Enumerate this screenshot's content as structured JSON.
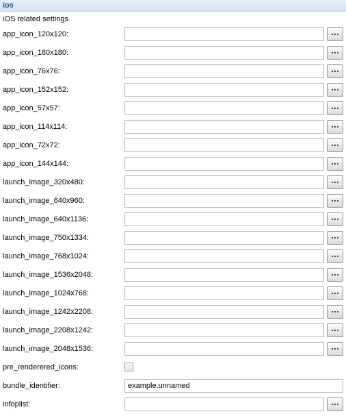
{
  "header": {
    "title": "ios"
  },
  "section_heading": "iOS related settings",
  "rows": [
    {
      "key": "app_icon_120x120",
      "label": "app_icon_120x120:",
      "type": "file",
      "value": ""
    },
    {
      "key": "app_icon_180x180",
      "label": "app_icon_180x180:",
      "type": "file",
      "value": ""
    },
    {
      "key": "app_icon_76x76",
      "label": "app_icon_76x76:",
      "type": "file",
      "value": ""
    },
    {
      "key": "app_icon_152x152",
      "label": "app_icon_152x152:",
      "type": "file",
      "value": ""
    },
    {
      "key": "app_icon_57x57",
      "label": "app_icon_57x57:",
      "type": "file",
      "value": ""
    },
    {
      "key": "app_icon_114x114",
      "label": "app_icon_114x114:",
      "type": "file",
      "value": ""
    },
    {
      "key": "app_icon_72x72",
      "label": "app_icon_72x72:",
      "type": "file",
      "value": ""
    },
    {
      "key": "app_icon_144x144",
      "label": "app_icon_144x144:",
      "type": "file",
      "value": ""
    },
    {
      "key": "launch_image_320x480",
      "label": "launch_image_320x480:",
      "type": "file",
      "value": ""
    },
    {
      "key": "launch_image_640x960",
      "label": "launch_image_640x960:",
      "type": "file",
      "value": ""
    },
    {
      "key": "launch_image_640x1136",
      "label": "launch_image_640x1136:",
      "type": "file",
      "value": ""
    },
    {
      "key": "launch_image_750x1334",
      "label": "launch_image_750x1334:",
      "type": "file",
      "value": ""
    },
    {
      "key": "launch_image_768x1024",
      "label": "launch_image_768x1024:",
      "type": "file",
      "value": ""
    },
    {
      "key": "launch_image_1536x2048",
      "label": "launch_image_1536x2048:",
      "type": "file",
      "value": ""
    },
    {
      "key": "launch_image_1024x768",
      "label": "launch_image_1024x768:",
      "type": "file",
      "value": ""
    },
    {
      "key": "launch_image_1242x2208",
      "label": "launch_image_1242x2208:",
      "type": "file",
      "value": ""
    },
    {
      "key": "launch_image_2208x1242",
      "label": "launch_image_2208x1242:",
      "type": "file",
      "value": ""
    },
    {
      "key": "launch_image_2048x1536",
      "label": "launch_image_2048x1536:",
      "type": "file",
      "value": ""
    },
    {
      "key": "pre_renderered_icons",
      "label": "pre_renderered_icons:",
      "type": "check",
      "checked": false
    },
    {
      "key": "bundle_identifier",
      "label": "bundle_identifier:",
      "type": "text",
      "value": "example.unnamed"
    },
    {
      "key": "infoplist",
      "label": "infoplist:",
      "type": "file",
      "value": ""
    }
  ]
}
